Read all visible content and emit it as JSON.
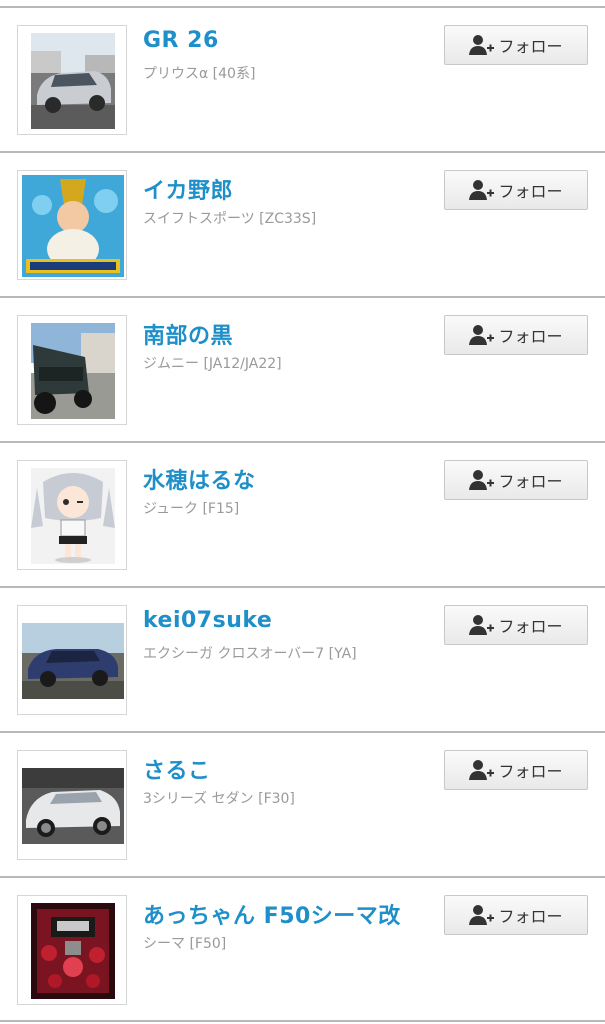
{
  "follow_label": "フォロー",
  "icons": {
    "follow": "add-user-icon"
  },
  "users": [
    {
      "name": "GR 26",
      "car": "プリウスα [40系]"
    },
    {
      "name": "イカ野郎",
      "car": "スイフトスポーツ [ZC33S]"
    },
    {
      "name": "南部の黒",
      "car": "ジムニー [JA12/JA22]"
    },
    {
      "name": "水穂はるな",
      "car": "ジューク [F15]"
    },
    {
      "name": "kei07suke",
      "car": "エクシーガ クロスオーバー7 [YA]"
    },
    {
      "name": "さるこ",
      "car": "3シリーズ セダン [F30]"
    },
    {
      "name": "あっちゃん F50シーマ改",
      "car": "シーマ [F50]"
    }
  ],
  "colors": {
    "name": "#1e8fc8",
    "subtext": "#9a9a9a",
    "divider": "#b9b9b9"
  }
}
